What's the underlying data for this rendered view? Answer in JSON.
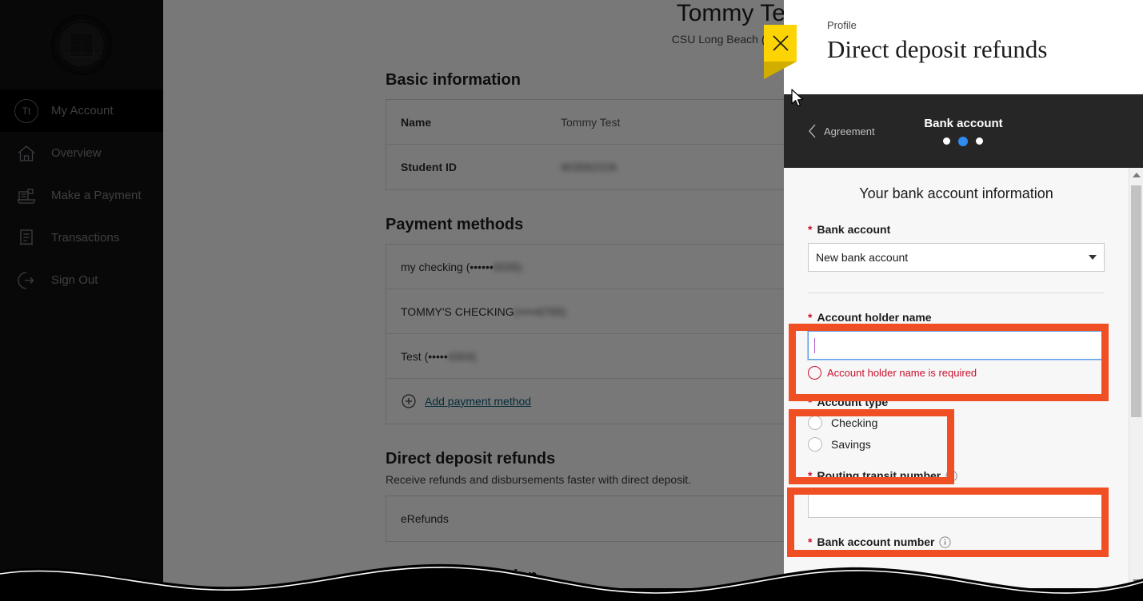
{
  "sidebar": {
    "logo_alt": "California State University Long Beach seal",
    "logo_text": "CALIFORNIA STATE UNIVERSITY LONG BEACH",
    "items": [
      {
        "label": "My Account",
        "icon": "avatar-icon",
        "initials": "Tt",
        "active": true
      },
      {
        "label": "Overview",
        "icon": "home-icon",
        "active": false
      },
      {
        "label": "Make a Payment",
        "icon": "register-icon",
        "active": false
      },
      {
        "label": "Transactions",
        "icon": "receipt-icon",
        "active": false
      },
      {
        "label": "Sign Out",
        "icon": "sign-out-icon",
        "active": false
      }
    ]
  },
  "main": {
    "account_name": "Tommy Test",
    "institution": "CSU Long Beach (Training)",
    "basic": {
      "heading": "Basic information",
      "rows": [
        {
          "key": "Name",
          "value": "Tommy Test",
          "blurred": false
        },
        {
          "key": "Student ID",
          "value": "903562226",
          "blurred": true
        }
      ]
    },
    "payment_methods": {
      "heading": "Payment methods",
      "items": [
        {
          "label": "my checking (••••••",
          "masked": "6535)"
        },
        {
          "label": "TOMMY'S CHECKING",
          "masked": "(•••••6789)"
        },
        {
          "label": "Test (•••••",
          "masked": "4304)"
        }
      ],
      "add_label": "Add payment method"
    },
    "direct_deposit": {
      "heading": "Direct deposit refunds",
      "subtext": "Receive refunds and disbursements faster with direct deposit.",
      "item": "eRefunds"
    },
    "contact_heading": "Contact information"
  },
  "modal": {
    "eyebrow": "Profile",
    "title": "Direct deposit refunds",
    "close_label": "Close",
    "back_label": "Agreement",
    "step_title": "Bank account",
    "step_count": 3,
    "step_current": 2,
    "form": {
      "title": "Your bank account information",
      "bank_account_label": "Bank account",
      "bank_account_value": "New bank account",
      "account_holder_label": "Account holder name",
      "account_holder_value": "",
      "account_holder_error": "Account holder name is required",
      "account_type_label": "Account type",
      "account_type_options": [
        "Checking",
        "Savings"
      ],
      "routing_label": "Routing transit number",
      "routing_value": "",
      "bank_account_number_label": "Bank account number",
      "required_marker": "*",
      "info_icon": "i"
    }
  },
  "annotations": {
    "highlight_color": "#f04e23",
    "boxes": [
      "account-holder-name",
      "account-type",
      "routing-transit-number"
    ]
  },
  "colors": {
    "accent_blue": "#2f8cf0",
    "close_yellow": "#fcd303",
    "required_red": "#c8102e",
    "sidebar_bg": "#1a1a1a",
    "nav_bar_bg": "#262626"
  }
}
